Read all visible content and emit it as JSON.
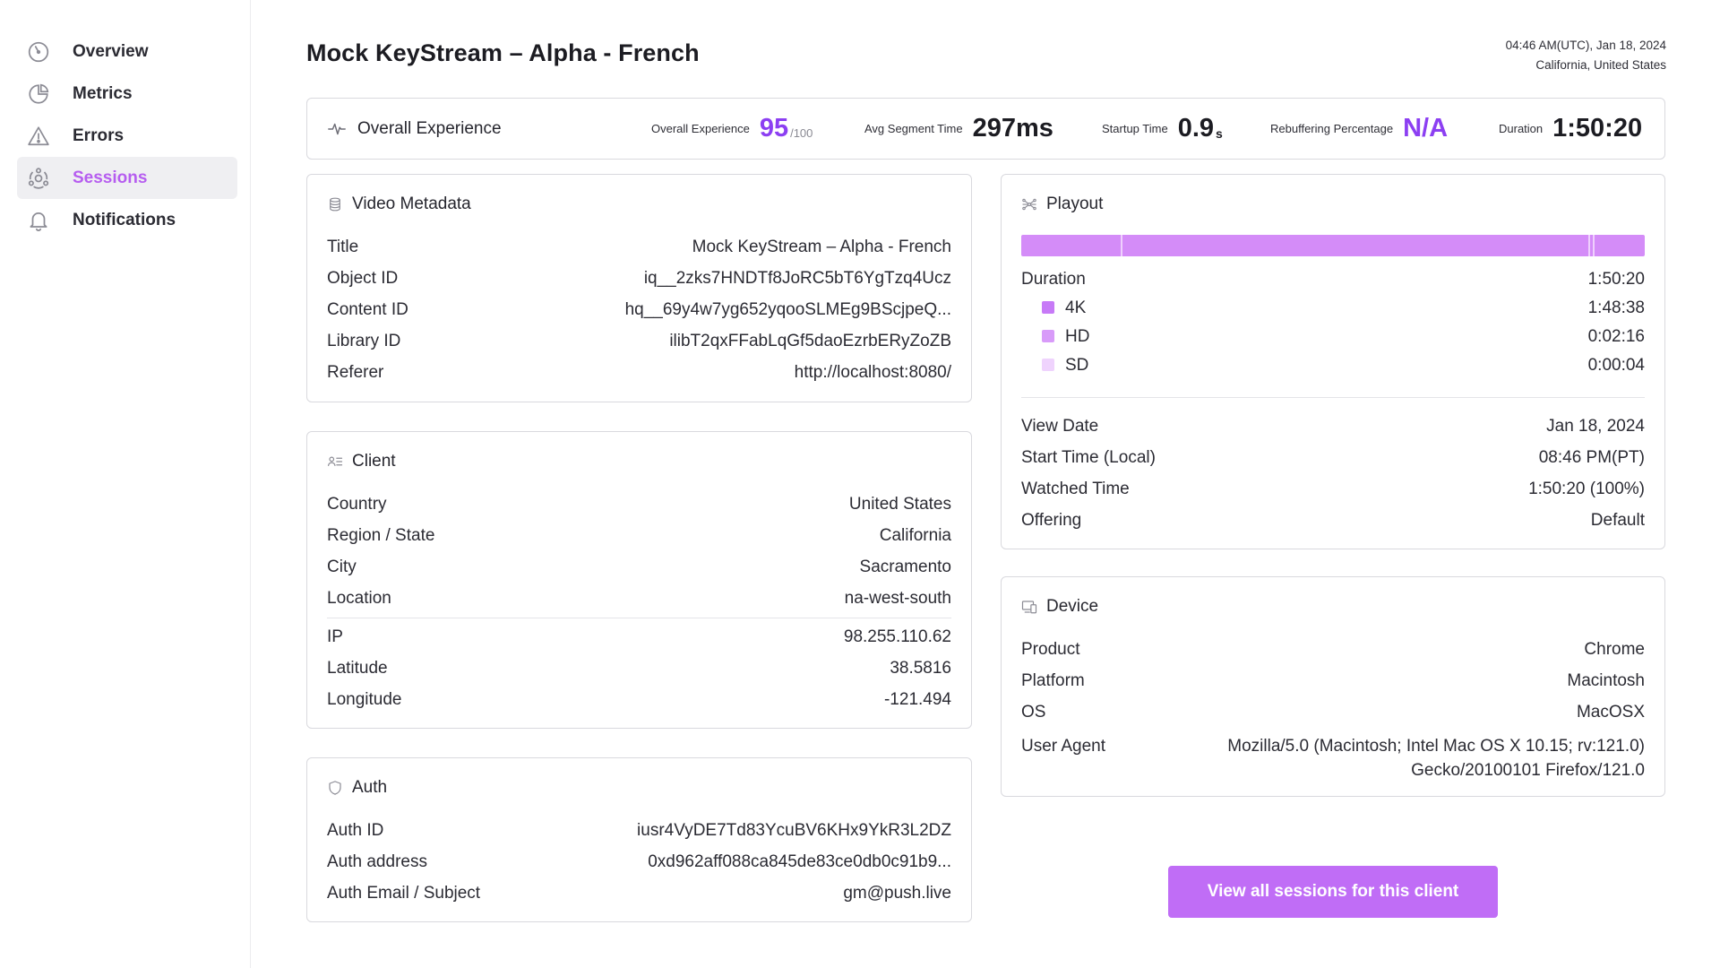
{
  "sidebar": {
    "items": [
      {
        "label": "Overview",
        "icon": "gauge-icon"
      },
      {
        "label": "Metrics",
        "icon": "pie-chart-icon"
      },
      {
        "label": "Errors",
        "icon": "warning-icon"
      },
      {
        "label": "Sessions",
        "icon": "sessions-icon",
        "active": true
      },
      {
        "label": "Notifications",
        "icon": "bell-icon"
      }
    ]
  },
  "header": {
    "title": "Mock KeyStream – Alpha - French",
    "timestamp": "04:46 AM(UTC), Jan 18, 2024",
    "location": "California, United States"
  },
  "summary": {
    "title": "Overall Experience",
    "experience_label": "Overall Experience",
    "experience_value": "95",
    "experience_unit": "/100",
    "segment_label": "Avg Segment Time",
    "segment_value": "297ms",
    "startup_label": "Startup Time",
    "startup_value": "0.9",
    "startup_unit": "s",
    "rebuffer_label": "Rebuffering Percentage",
    "rebuffer_value": "N/A",
    "duration_label": "Duration",
    "duration_value": "1:50:20"
  },
  "video_metadata": {
    "title": "Video Metadata",
    "rows": [
      {
        "label": "Title",
        "value": "Mock KeyStream – Alpha - French"
      },
      {
        "label": "Object ID",
        "value": "iq__2zks7HNDTf8JoRC5bT6YgTzq4Ucz"
      },
      {
        "label": "Content ID",
        "value": "hq__69y4w7yg652yqooSLMEg9BScjpeQ..."
      },
      {
        "label": "Library ID",
        "value": "ilibT2qxFFabLqGf5daoEzrbERyZoZB"
      },
      {
        "label": "Referer",
        "value": "http://localhost:8080/"
      }
    ]
  },
  "client": {
    "title": "Client",
    "rows": [
      {
        "label": "Country",
        "value": "United States"
      },
      {
        "label": "Region / State",
        "value": "California"
      },
      {
        "label": "City",
        "value": "Sacramento"
      },
      {
        "label": "Location",
        "value": "na-west-south"
      }
    ],
    "rows2": [
      {
        "label": "IP",
        "value": "98.255.110.62"
      },
      {
        "label": "Latitude",
        "value": "38.5816"
      },
      {
        "label": "Longitude",
        "value": "-121.494"
      }
    ]
  },
  "auth": {
    "title": "Auth",
    "rows": [
      {
        "label": "Auth ID",
        "value": "iusr4VyDE7Td83YcuBV6KHx9YkR3L2DZ"
      },
      {
        "label": "Auth address",
        "value": "0xd962aff088ca845de83ce0db0c91b9..."
      },
      {
        "label": "Auth Email / Subject",
        "value": "gm@push.live"
      }
    ]
  },
  "playout": {
    "title": "Playout",
    "bar_markers_fraction": [
      0.159,
      0.91,
      0.917
    ],
    "duration_label": "Duration",
    "duration_value": "1:50:20",
    "qualities": [
      {
        "label": "4K",
        "value": "1:48:38",
        "color": "#c77af7"
      },
      {
        "label": "HD",
        "value": "0:02:16",
        "color": "#d89bf9"
      },
      {
        "label": "SD",
        "value": "0:00:04",
        "color": "#efd3fd"
      }
    ],
    "rows": [
      {
        "label": "View Date",
        "value": "Jan 18, 2024"
      },
      {
        "label": "Start Time (Local)",
        "value": "08:46 PM(PT)"
      },
      {
        "label": "Watched Time",
        "value": "1:50:20 (100%)"
      },
      {
        "label": "Offering",
        "value": "Default"
      }
    ]
  },
  "device": {
    "title": "Device",
    "rows": [
      {
        "label": "Product",
        "value": "Chrome"
      },
      {
        "label": "Platform",
        "value": "Macintosh"
      },
      {
        "label": "OS",
        "value": "MacOSX"
      }
    ],
    "user_agent_label": "User Agent",
    "user_agent_line1": "Mozilla/5.0 (Macintosh; Intel Mac OS X 10.15; rv:121.0)",
    "user_agent_line2": "Gecko/20100101 Firefox/121.0"
  },
  "cta_label": "View all sessions for this client",
  "colors": {
    "accent": "#8c3ff2",
    "active_nav": "#b65df0",
    "button": "#c06df6"
  }
}
